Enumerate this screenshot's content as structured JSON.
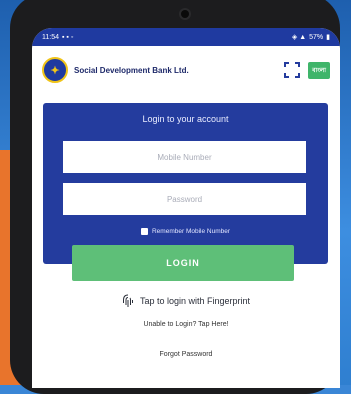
{
  "statusbar": {
    "time": "11:54",
    "battery": "57%"
  },
  "header": {
    "bank_name": "Social Development Bank Ltd.",
    "lang_label": "বাংলা"
  },
  "login": {
    "title": "Login to your account",
    "mobile_placeholder": "Mobile Number",
    "password_placeholder": "Password",
    "remember_label": "Remember Mobile Number",
    "button_label": "LOGIN"
  },
  "fingerprint_label": "Tap to login with Fingerprint",
  "help_link": "Unable to Login? Tap Here!",
  "forgot_link": "Forgot Password",
  "colors": {
    "primary_blue": "#243c9e",
    "login_green": "#5ebf78",
    "orange_accent": "#e8742c"
  }
}
